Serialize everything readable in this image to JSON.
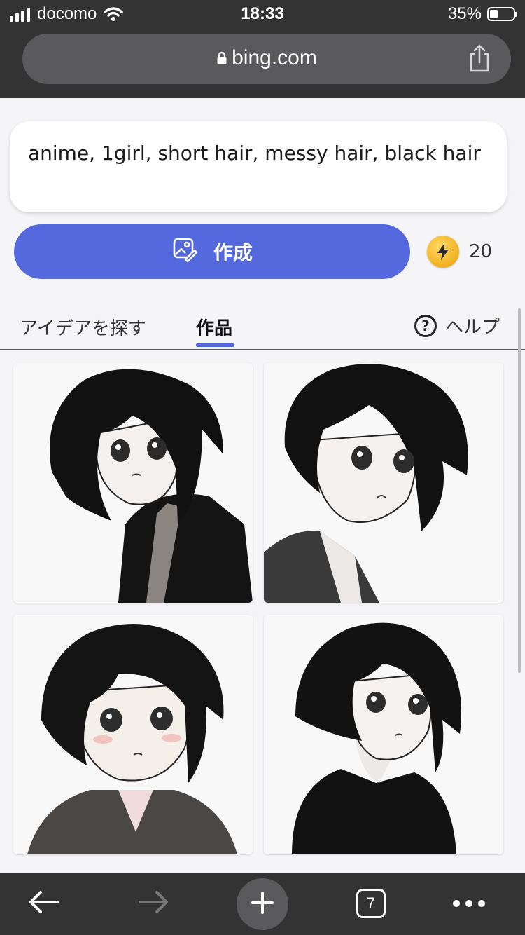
{
  "status_bar": {
    "carrier": "docomo",
    "time": "18:33",
    "battery_percent": "35%",
    "battery_level": 0.35
  },
  "browser": {
    "url": "bing.com",
    "tab_count": "7"
  },
  "prompt": {
    "text": "anime, 1girl, short hair, messy hair, black hair"
  },
  "create_button": {
    "label": "作成"
  },
  "boosts": {
    "count": "20"
  },
  "tabs": [
    {
      "label": "アイデアを探す",
      "active": false
    },
    {
      "label": "作品",
      "active": true
    }
  ],
  "help": {
    "label": "ヘルプ",
    "icon": "?"
  },
  "images": [
    {
      "description_icon": "generated-image"
    },
    {
      "description_icon": "generated-image"
    },
    {
      "description_icon": "generated-image"
    },
    {
      "description_icon": "generated-image"
    }
  ],
  "colors": {
    "accent": "#5469dd",
    "chrome": "#333333",
    "coin": "#f0b020"
  }
}
